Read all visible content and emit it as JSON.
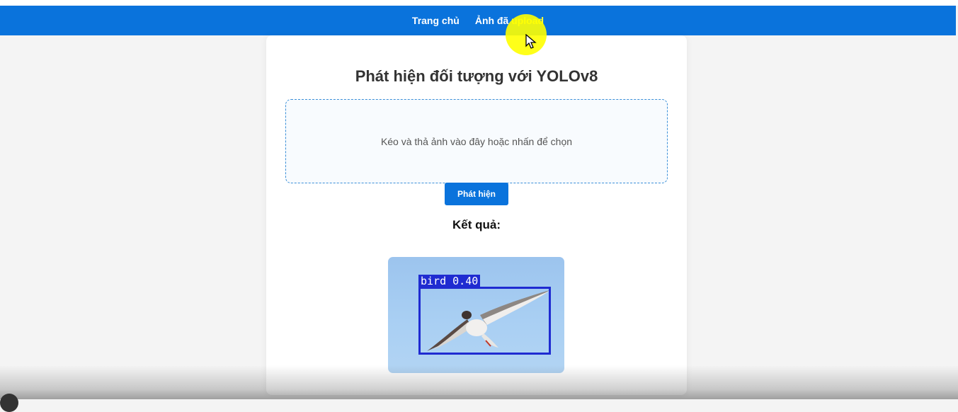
{
  "nav": {
    "home_label": "Trang chủ",
    "uploaded_label_prefix": "Ảnh đã ",
    "uploaded_label_highlight": "upload"
  },
  "main": {
    "title": "Phát hiện đối tượng với YOLOv8",
    "dropzone_text": "Kéo và thả ảnh vào đây hoặc nhấn để chọn",
    "detect_button_label": "Phát hiện",
    "result_label": "Kết quả:"
  },
  "result": {
    "detection_label": "bird 0.40"
  },
  "colors": {
    "accent": "#0a73dc",
    "bbox": "#1f2bd1",
    "cursor_highlight": "#ffff00"
  }
}
